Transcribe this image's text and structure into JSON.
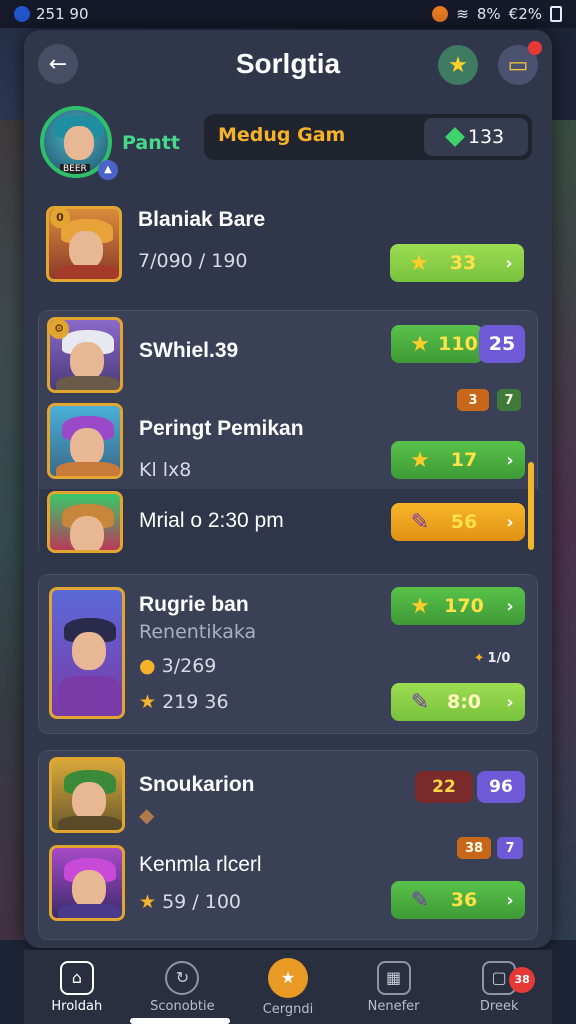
{
  "status": {
    "time": "251 90",
    "battery": "8%",
    "signal_pct": "€2%"
  },
  "header": {
    "title": "Sorlgtia"
  },
  "profile": {
    "name": "Pantt",
    "game": "Medug Gam",
    "gems": "133",
    "avatar_tag": "BEER"
  },
  "featured": {
    "name": "Blaniak Bare",
    "progress": "7/090 / 190",
    "reward": "33"
  },
  "group1": [
    {
      "name": "SWhiel.39",
      "reward": "110",
      "side": "25"
    },
    {
      "name": "Peringt Pemikan",
      "sub": "Kl lx8",
      "reward": "17",
      "minis": [
        "3",
        "7"
      ]
    },
    {
      "name": "Mrial o 2:30 pm",
      "reward": "56"
    }
  ],
  "group2": {
    "name": "Rugrie ban",
    "sub": "Renentikaka",
    "stat1": "3/269",
    "stat2": "219 36",
    "reward1": "170",
    "reward2": "8:0",
    "mini": "1/0"
  },
  "group3": [
    {
      "name": "Snoukarion",
      "red": "22",
      "purple": "96"
    },
    {
      "name": "Kenmla rlcerl",
      "sub": "59 / 100",
      "reward": "36",
      "minis": [
        "38",
        "7"
      ]
    }
  ],
  "nav": [
    {
      "label": "Hroldah",
      "icon": "home-icon"
    },
    {
      "label": "Sconobtie",
      "icon": "refresh-icon"
    },
    {
      "label": "Cergndi",
      "icon": "star-icon"
    },
    {
      "label": "Nenefer",
      "icon": "grid-icon"
    },
    {
      "label": "Dreek",
      "icon": "cup-icon",
      "badge": "38"
    }
  ]
}
